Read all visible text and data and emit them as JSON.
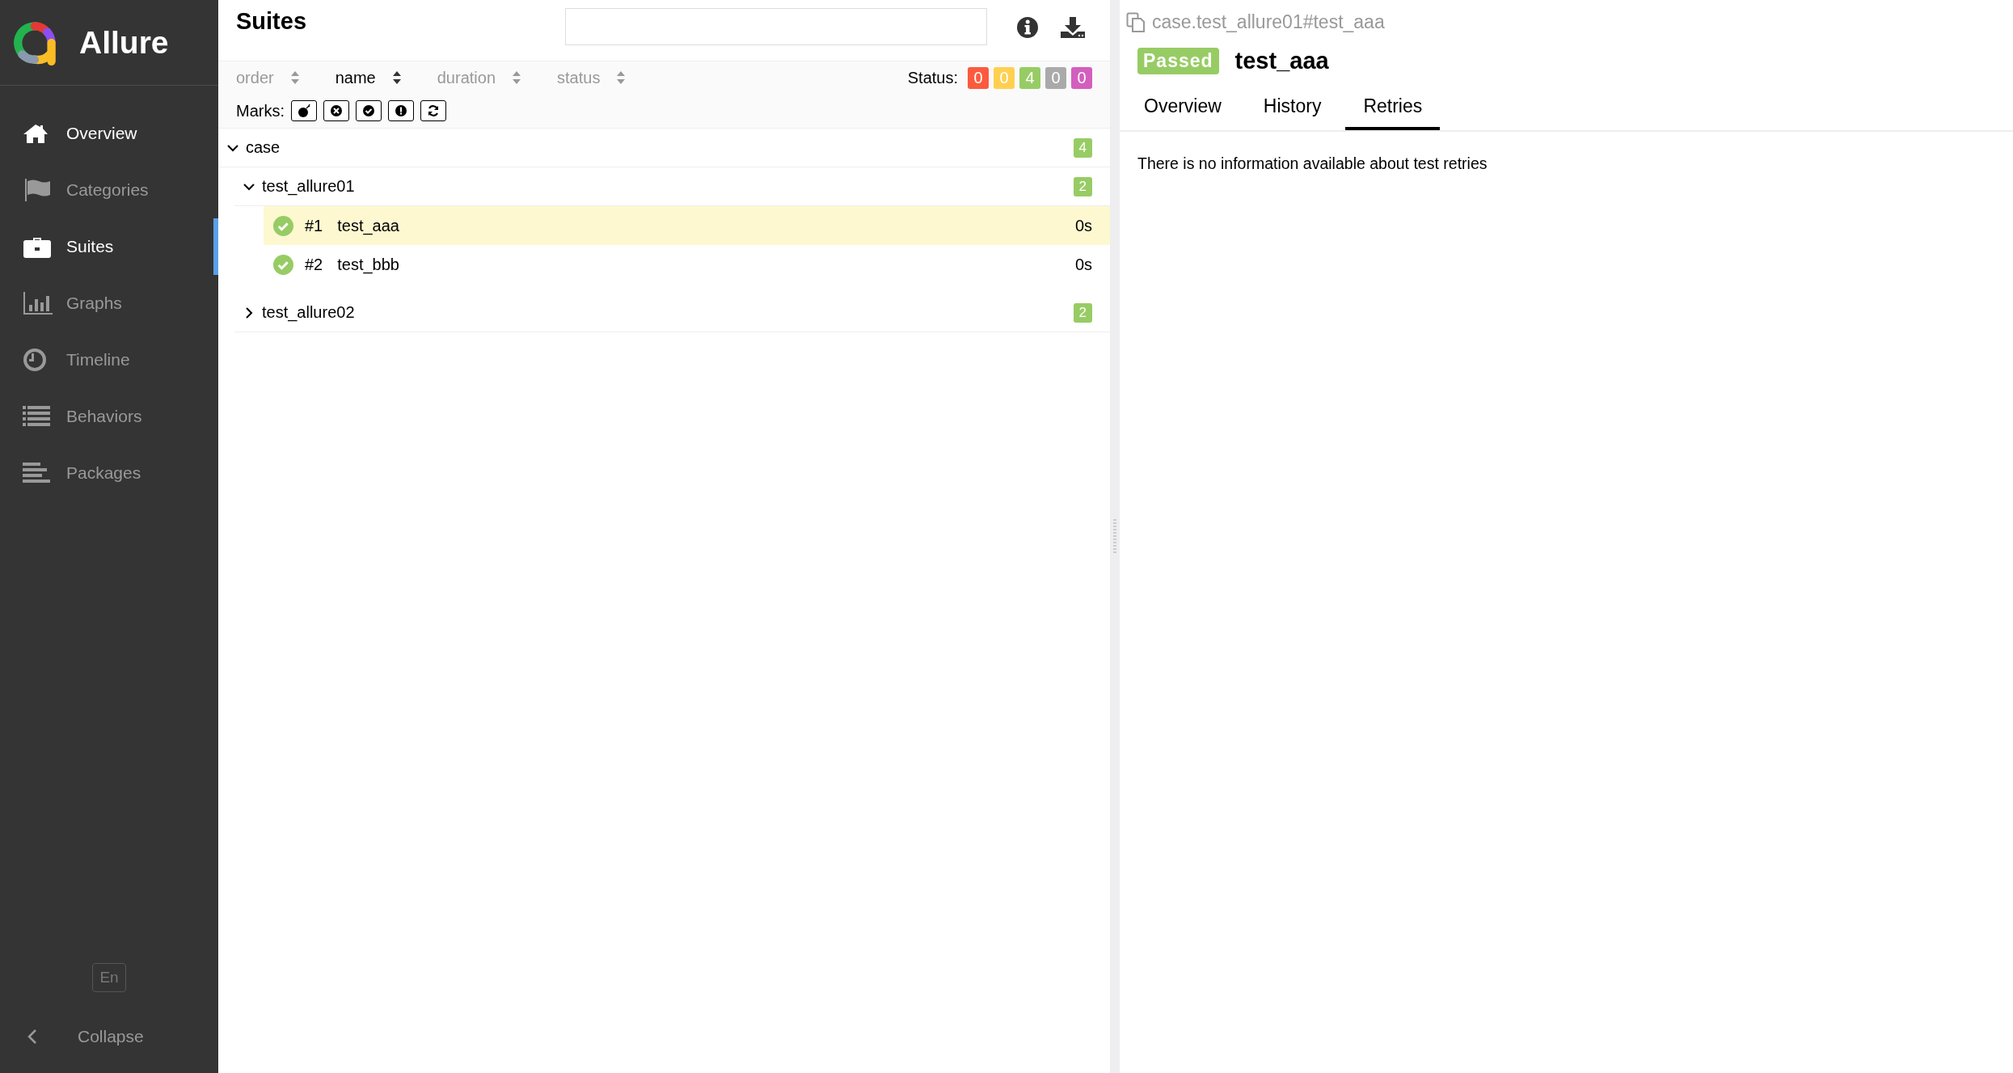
{
  "sidebar": {
    "logo_text": "Allure",
    "items": [
      {
        "label": "Overview",
        "selected": false,
        "hovered": true
      },
      {
        "label": "Categories",
        "selected": false,
        "hovered": false
      },
      {
        "label": "Suites",
        "selected": true,
        "hovered": false
      },
      {
        "label": "Graphs",
        "selected": false,
        "hovered": false
      },
      {
        "label": "Timeline",
        "selected": false,
        "hovered": false
      },
      {
        "label": "Behaviors",
        "selected": false,
        "hovered": false
      },
      {
        "label": "Packages",
        "selected": false,
        "hovered": false
      }
    ],
    "language": "En",
    "collapse": "Collapse"
  },
  "suites": {
    "title": "Suites",
    "sort_columns": [
      {
        "label": "order",
        "active": false
      },
      {
        "label": "name",
        "active": true
      },
      {
        "label": "duration",
        "active": false
      },
      {
        "label": "status",
        "active": false
      }
    ],
    "status_label": "Status:",
    "status_counts": [
      {
        "count": "0",
        "color": "#fd5a3e"
      },
      {
        "count": "0",
        "color": "#ffd050"
      },
      {
        "count": "4",
        "color": "#97cc64"
      },
      {
        "count": "0",
        "color": "#aaaaaa"
      },
      {
        "count": "0",
        "color": "#d35ebe"
      }
    ],
    "marks_label": "Marks:",
    "tree": [
      {
        "name": "case",
        "count": "4",
        "expanded": true,
        "children": [
          {
            "name": "test_allure01",
            "count": "2",
            "expanded": true,
            "children": [
              {
                "kind": "test",
                "number": "#1",
                "name": "test_aaa",
                "duration": "0s",
                "selected": true
              },
              {
                "kind": "test",
                "number": "#2",
                "name": "test_bbb",
                "duration": "0s",
                "selected": false
              }
            ]
          },
          {
            "name": "test_allure02",
            "count": "2",
            "expanded": false
          }
        ]
      }
    ]
  },
  "result": {
    "path": "case.test_allure01#test_aaa",
    "status": "Passed",
    "title": "test_aaa",
    "tabs": [
      {
        "label": "Overview",
        "selected": false
      },
      {
        "label": "History",
        "selected": false
      },
      {
        "label": "Retries",
        "selected": true
      }
    ],
    "message": "There is no information available about test retries"
  }
}
